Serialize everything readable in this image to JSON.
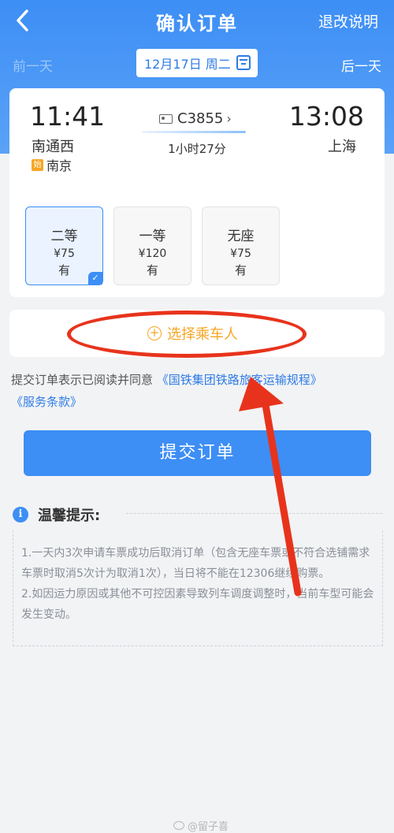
{
  "header": {
    "back_icon": "chevron-left-icon",
    "title": "确认订单",
    "refund_link": "退改说明"
  },
  "datebar": {
    "prev_day": "前一天",
    "next_day": "后一天",
    "date": "12月17日 周二",
    "calendar_icon": "calendar-icon"
  },
  "train": {
    "departure_time": "11:41",
    "departure_station": "南通西",
    "origin_badge": "始",
    "origin_station": "南京",
    "train_number": "C3855",
    "train_chevron": "›",
    "duration": "1小时27分",
    "arrival_time": "13:08",
    "arrival_station": "上海"
  },
  "seats": [
    {
      "name": "二等",
      "price": "¥75",
      "availability": "有",
      "selected": true
    },
    {
      "name": "一等",
      "price": "¥120",
      "availability": "有",
      "selected": false
    },
    {
      "name": "无座",
      "price": "¥75",
      "availability": "有",
      "selected": false
    }
  ],
  "passenger": {
    "plus_icon_glyph": "+",
    "label": "选择乘车人"
  },
  "agreement": {
    "prefix": "提交订单表示已阅读并同意 ",
    "link1": "《国铁集团铁路旅客运输规程》",
    "link2": "《服务条款》"
  },
  "submit_label": "提交订单",
  "tips": {
    "icon_glyph": "i",
    "title": "温馨提示:",
    "item1": "1.一天内3次申请车票成功后取消订单（包含无座车票或不符合选铺需求车票时取消5次计为取消1次），当日将不能在12306继续购票。",
    "item2": "2.如因运力原因或其他不可控因素导致列车调度调整时，当前车型可能会发生变动。"
  },
  "annotation_color": "#e8331c",
  "accent_color": "#3d8ef5",
  "watermark": "@留子喜"
}
